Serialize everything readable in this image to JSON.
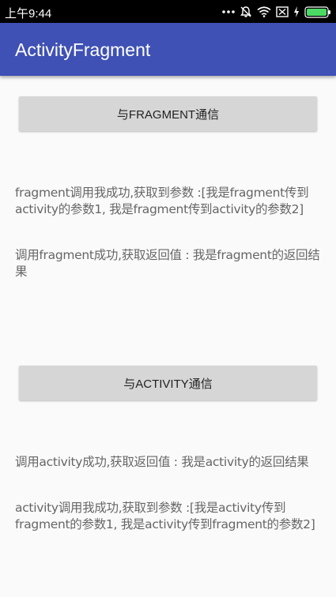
{
  "status_bar": {
    "time": "上午9:44",
    "icons": [
      "more-dots-icon",
      "notification-off-icon",
      "wifi-icon",
      "sim-off-icon",
      "charging-icon",
      "battery-icon"
    ]
  },
  "app_bar": {
    "title": "ActivityFragment"
  },
  "buttons": {
    "fragment_comm": "与FRAGMENT通信",
    "activity_comm": "与ACTIVITY通信"
  },
  "texts": {
    "fragment_call_result": "fragment调用我成功,获取到参数 :[我是fragment传到activity的参数1, 我是fragment传到activity的参数2]",
    "call_fragment_return": "调用fragment成功,获取返回值 : 我是fragment的返回结果",
    "call_activity_return": "调用activity成功,获取返回值 : 我是activity的返回结果",
    "activity_call_result": "activity调用我成功,获取到参数 :[我是activity传到fragment的参数1, 我是activity传到fragment的参数2]"
  },
  "colors": {
    "primary": "#3f51b5",
    "status_bar": "#000000",
    "button": "#d6d6d6",
    "battery": "#4cd964"
  }
}
